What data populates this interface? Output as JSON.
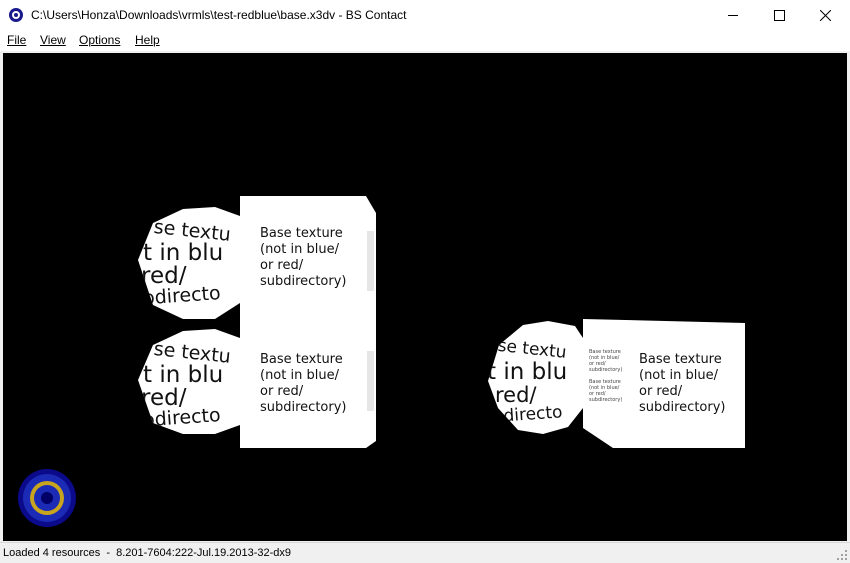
{
  "window": {
    "title": "C:\\Users\\Honza\\Downloads\\vrmls\\test-redblue\\base.x3dv - BS Contact",
    "minimize_icon": "minimize-icon",
    "maximize_icon": "maximize-icon",
    "close_icon": "close-icon"
  },
  "menu": {
    "file": "File",
    "view": "View",
    "options": "Options",
    "help": "Help"
  },
  "scene": {
    "texture_lines": [
      "Base texture",
      "(not in blue/",
      "or red/",
      "subdirectory)"
    ],
    "sphere_words": [
      "se textu",
      "t in blu",
      "red/",
      "bdirecto"
    ],
    "background": "#000000",
    "surface": "#ffffff"
  },
  "status": {
    "text": "Loaded 4 resources  -  8.201-7604:222-Jul.19.2013-32-dx9"
  }
}
